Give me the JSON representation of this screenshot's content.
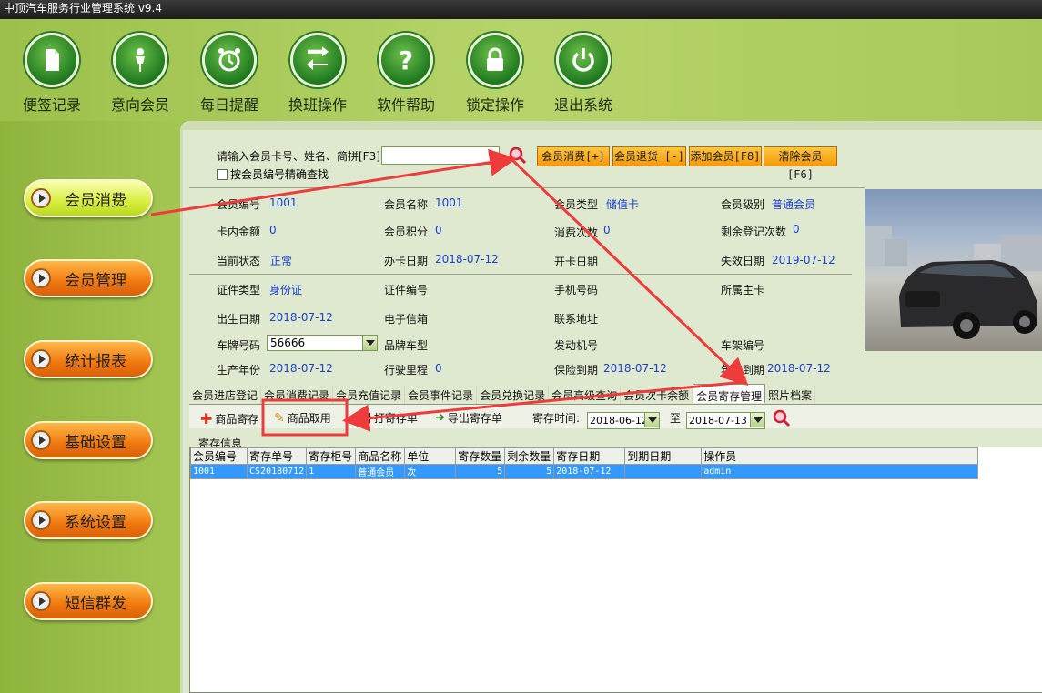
{
  "title": "中顶汽车服务行业管理系统 v9.4",
  "toolbar": [
    {
      "label": "便签记录",
      "icon": "note-icon"
    },
    {
      "label": "意向会员",
      "icon": "person-icon"
    },
    {
      "label": "每日提醒",
      "icon": "alarm-clock-icon"
    },
    {
      "label": "换班操作",
      "icon": "swap-arrows-icon"
    },
    {
      "label": "软件帮助",
      "icon": "help-question-icon"
    },
    {
      "label": "锁定操作",
      "icon": "lock-icon"
    },
    {
      "label": "退出系统",
      "icon": "power-icon"
    }
  ],
  "sidebar": [
    {
      "label": "会员消费",
      "active": true
    },
    {
      "label": "会员管理"
    },
    {
      "label": "统计报表"
    },
    {
      "label": "基础设置"
    },
    {
      "label": "系统设置"
    },
    {
      "label": "短信群发"
    }
  ],
  "search": {
    "prompt": "请输入会员卡号、姓名、简拼[F3]",
    "value": "",
    "exact_label": "按会员编号精确查找"
  },
  "actions": [
    "会员消费[+]",
    "会员退货 [-]",
    "添加会员[F8]",
    "清除会员 [F6]"
  ],
  "fields": {
    "member_no": {
      "label": "会员编号",
      "value": "1001"
    },
    "member_name": {
      "label": "会员名称",
      "value": "1001"
    },
    "member_type": {
      "label": "会员类型",
      "value": "储值卡"
    },
    "member_level": {
      "label": "会员级别",
      "value": "普通会员"
    },
    "card_balance": {
      "label": "卡内金额",
      "value": "0"
    },
    "points": {
      "label": "会员积分",
      "value": "0"
    },
    "consume_count": {
      "label": "消费次数",
      "value": "0"
    },
    "remaining_count": {
      "label": "剩余登记次数",
      "value": "0"
    },
    "status": {
      "label": "当前状态",
      "value": "正常"
    },
    "issue_date": {
      "label": "办卡日期",
      "value": "2018-07-12"
    },
    "open_date": {
      "label": "开卡日期",
      "value": ""
    },
    "expire_date": {
      "label": "失效日期",
      "value": "2019-07-12"
    },
    "id_type": {
      "label": "证件类型",
      "value": "身份证"
    },
    "id_no": {
      "label": "证件编号",
      "value": ""
    },
    "phone": {
      "label": "手机号码",
      "value": ""
    },
    "main_card": {
      "label": "所属主卡",
      "value": ""
    },
    "birthday": {
      "label": "出生日期",
      "value": "2018-07-12"
    },
    "email": {
      "label": "电子信箱",
      "value": ""
    },
    "address": {
      "label": "联系地址",
      "value": ""
    },
    "plate": {
      "label": "车牌号码",
      "value": "56666"
    },
    "car_model": {
      "label": "品牌车型",
      "value": ""
    },
    "engine_no": {
      "label": "发动机号",
      "value": ""
    },
    "frame_no": {
      "label": "车架编号",
      "value": ""
    },
    "production_year": {
      "label": "生产年份",
      "value": "2018-07-12"
    },
    "mileage": {
      "label": "行驶里程",
      "value": "0"
    },
    "insurance_due": {
      "label": "保险到期",
      "value": "2018-07-12"
    },
    "inspection_due": {
      "label": "年审到期",
      "value": "2018-07-12"
    }
  },
  "tabs": [
    "会员进店登记",
    "会员消费记录",
    "会员充值记录",
    "会员事件记录",
    "会员兑换记录",
    "会员高级查询",
    "会员次卡余额",
    "会员寄存管理",
    "照片档案"
  ],
  "active_tab": "会员寄存管理",
  "store_toolbar": {
    "deposit": "商品寄存",
    "pickup": "商品取用",
    "reprint": "补打寄存单",
    "export": "导出寄存单",
    "time_label": "寄存时间:",
    "from": "2018-06-12",
    "to_label": "至",
    "to": "2018-07-13"
  },
  "section_label": "寄存信息",
  "table": {
    "columns": [
      "会员编号",
      "寄存单号",
      "寄存柜号",
      "商品名称",
      "单位",
      "寄存数量",
      "剩余数量",
      "寄存日期",
      "到期日期",
      "操作员"
    ],
    "rows": [
      [
        "1001",
        "CS20180712",
        "1",
        "普通会员",
        "次",
        "5",
        "5",
        "2018-07-12",
        "",
        "admin"
      ]
    ]
  }
}
